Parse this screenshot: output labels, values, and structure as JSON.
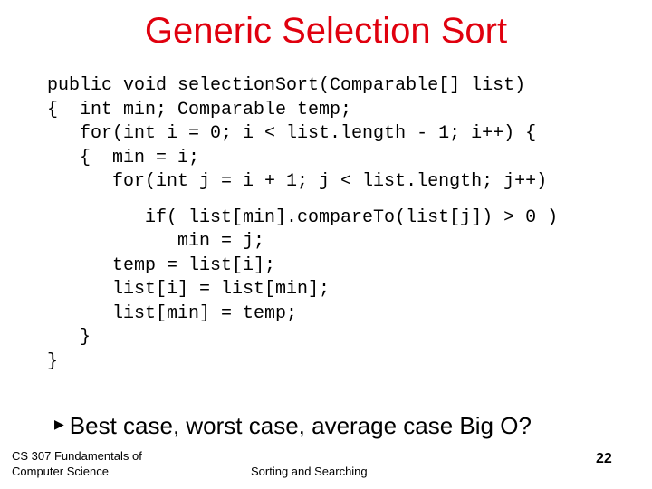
{
  "slide": {
    "title": "Generic Selection Sort",
    "title_color": "#e0000e",
    "code_lines": [
      "public void selectionSort(Comparable[] list)",
      "{  int min; Comparable temp;",
      "   for(int i = 0; i < list.length - 1; i++) {",
      "   {  min = i;",
      "      for(int j = i + 1; j < list.length; j++)",
      "         if( list[min].compareTo(list[j]) > 0 )",
      "            min = j;",
      "      temp = list[i];",
      "      list[i] = list[min];",
      "      list[min] = temp;",
      "   }",
      "}"
    ],
    "bullet": {
      "icon": "triangle-right-icon",
      "glyph": "▶",
      "text": "Best case, worst case, average case Big O?"
    },
    "footer": {
      "course_line1": "CS 307 Fundamentals of",
      "course_line2": "Computer Science",
      "topic": "Sorting and Searching",
      "page_number": "22"
    }
  }
}
